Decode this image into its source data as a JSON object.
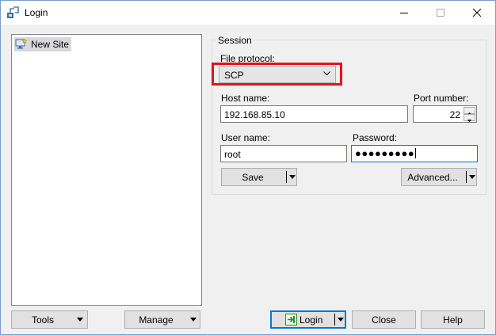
{
  "window": {
    "title": "Login",
    "icon": "winscp-app-icon",
    "controls": {
      "minimize": "minimize-icon",
      "maximize": "maximize-icon",
      "close": "close-icon"
    }
  },
  "sites": {
    "items": [
      {
        "label": "New Site",
        "icon": "new-site-icon"
      }
    ]
  },
  "session": {
    "title": "Session",
    "file_protocol": {
      "label": "File protocol:",
      "value": "SCP"
    },
    "host_name": {
      "label": "Host name:",
      "value": "192.168.85.10"
    },
    "port_number": {
      "label": "Port number:",
      "value": "22"
    },
    "user_name": {
      "label": "User name:",
      "value": "root"
    },
    "password": {
      "label": "Password:",
      "value": "●●●●●●●●●"
    },
    "save_label": "Save",
    "advanced_label": "Advanced..."
  },
  "footer": {
    "tools_label": "Tools",
    "manage_label": "Manage",
    "login_label": "Login",
    "close_label": "Close",
    "help_label": "Help"
  },
  "colors": {
    "highlight": "#e3131a",
    "focus": "#0078d7",
    "login_icon_green": "#2e8b2e"
  }
}
